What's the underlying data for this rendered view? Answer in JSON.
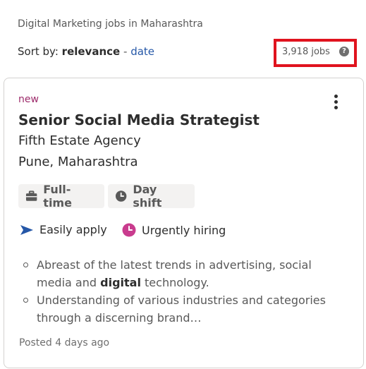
{
  "breadcrumb": "Digital Marketing jobs in Maharashtra",
  "sort": {
    "prefix": "Sort by:",
    "active": "relevance",
    "separator": "-",
    "alternate": "date"
  },
  "job_count": "3,918 jobs",
  "job": {
    "badge": "new",
    "title": "Senior Social Media Strategist",
    "company": "Fifth Estate Agency",
    "location": "Pune, Maharashtra",
    "tags": [
      {
        "label": "Full-time",
        "icon": "briefcase-icon"
      },
      {
        "label": "Day shift",
        "icon": "clock-icon"
      }
    ],
    "features": [
      {
        "label": "Easily apply",
        "icon": "send-arrow-icon"
      },
      {
        "label": "Urgently hiring",
        "icon": "urgent-clock-icon"
      }
    ],
    "snippet": {
      "line1_pre": "Abreast of the latest trends in advertising, social media and",
      "line1_bold": "digital",
      "line1_post": "technology.",
      "line2": "Understanding of various industries and categories through a discerning brand…"
    },
    "posted": "Posted 4 days ago"
  },
  "colors": {
    "highlight_box": "#e0131e",
    "new_badge": "#9d2b6b",
    "link": "#2557a7",
    "apply_icon": "#2557a7",
    "urgent_icon": "#c93c8e"
  }
}
